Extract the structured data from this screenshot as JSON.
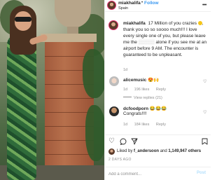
{
  "post": {
    "username": "miakhalifa",
    "follow_label": "Follow",
    "separator": "•",
    "location": "Spain",
    "more_icon": "more-options-icon"
  },
  "caption": {
    "username": "miakhalifa",
    "text_part1": "17 Million of you crazies",
    "text_part2": ", thank you so so soooo much!!! I love every single one of you, but please leave me the",
    "censored": "▒▒▒▒▒",
    "text_part3": "alone if you see me at an airport before 9 AM. The encounter is guaranteed to be unpleasant.",
    "time": "1d"
  },
  "comments": [
    {
      "username": "alicemusic",
      "text": "",
      "emoji": "😍🙌",
      "time": "1d",
      "likes": "196 likes",
      "reply_label": "Reply",
      "view_replies": "View replies (21)"
    },
    {
      "username": "dcfoodporn",
      "text_inline": "😂😂😂",
      "text": "Congrats!!!!",
      "time": "1d",
      "likes": "184 likes",
      "reply_label": "Reply"
    }
  ],
  "likes": {
    "prefix": "Liked by",
    "user": "f_andersoon",
    "connector": "and",
    "others": "1,149,947 others"
  },
  "date": "2 DAYS AGO",
  "add_comment": {
    "placeholder": "Add a comment...",
    "post_label": "Post"
  },
  "colors": {
    "follow_blue": "#3897f0",
    "post_disabled": "#b2dffc",
    "meta_gray": "#8e8e8e"
  }
}
